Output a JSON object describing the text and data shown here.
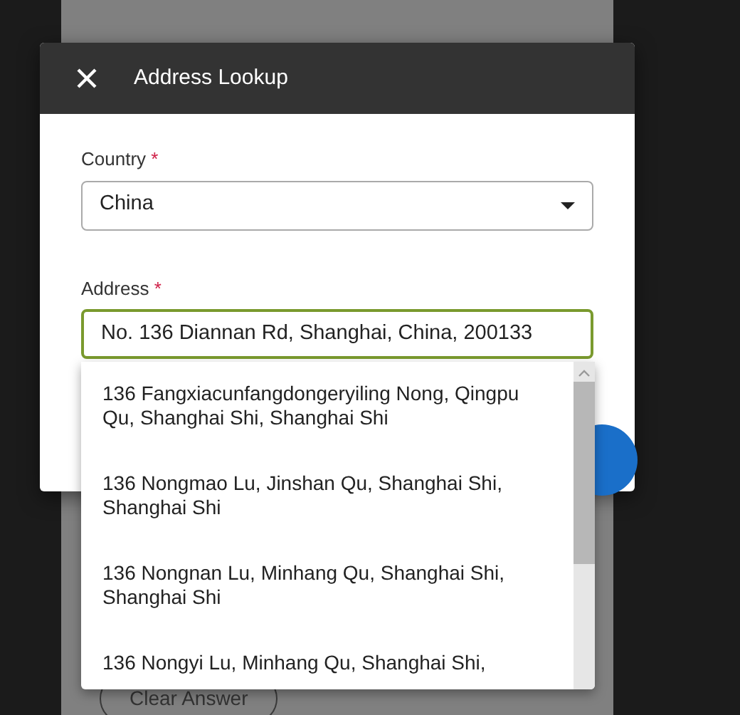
{
  "background_form": {
    "clear_button": "Clear Answer"
  },
  "dialog": {
    "title": "Address Lookup",
    "fields": [
      {
        "kind": "select",
        "label": "Country",
        "required_mark": "*",
        "value": "China",
        "focused": false
      },
      {
        "kind": "text",
        "label": "Address",
        "required_mark": "*",
        "value": "No. 136 Diannan Rd, Shanghai, China, 200133",
        "focused": true
      }
    ]
  },
  "suggestions": [
    {
      "text": "136 Fangxiacunfangdongeryiling Nong, Qingpu Qu, Shanghai Shi, Shanghai Shi"
    },
    {
      "text": "136 Nongmao Lu, Jinshan Qu, Shanghai Shi, Shanghai Shi"
    },
    {
      "text": "136 Nongnan Lu, Minhang Qu, Shanghai Shi, Shanghai Shi"
    },
    {
      "text": "136 Nongyi Lu, Minhang Qu, Shanghai Shi,"
    }
  ]
}
